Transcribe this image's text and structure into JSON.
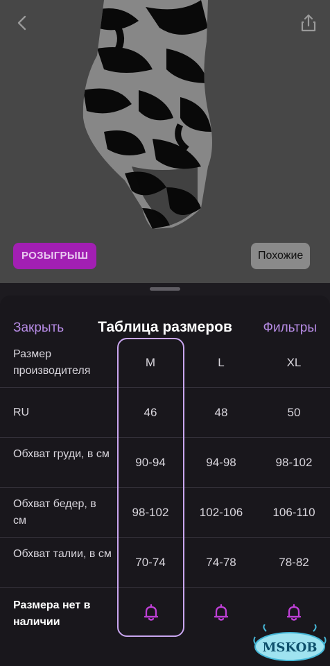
{
  "product": {
    "raffle_badge": "РОЗЫГРЫШ",
    "similar_button": "Похожие",
    "back_icon": "chevron-left-icon",
    "share_icon": "share-icon"
  },
  "sheet": {
    "close_label": "Закрыть",
    "title": "Таблица размеров",
    "filters_label": "Фильтры"
  },
  "size_table": {
    "header": {
      "label": "Размер производителя",
      "sizes": [
        "M",
        "L",
        "XL"
      ]
    },
    "rows": [
      {
        "label": "RU",
        "values": [
          "46",
          "48",
          "50"
        ]
      },
      {
        "label": "Обхват груди, в см",
        "values": [
          "90-94",
          "94-98",
          "98-102"
        ]
      },
      {
        "label": "Обхват бедер, в см",
        "values": [
          "98-102",
          "102-106",
          "106-110"
        ]
      },
      {
        "label": "Обхват талии, в см",
        "values": [
          "70-74",
          "74-78",
          "78-82"
        ]
      }
    ],
    "availability": {
      "label": "Размера нет в наличии",
      "icon": "bell-icon"
    },
    "selected_size": "M"
  },
  "colors": {
    "accent": "#b68be4",
    "raffle": "#a21fb3",
    "bell": "#c040d8",
    "highlight": "#c9a6f0"
  },
  "watermark": {
    "text": "MSKOB"
  }
}
